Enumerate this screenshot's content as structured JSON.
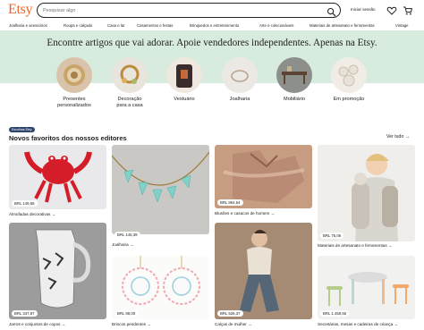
{
  "header": {
    "logo": "Etsy",
    "search_placeholder": "Pesquisar algo",
    "sign_in": "Iniciar sessão"
  },
  "nav": {
    "items": [
      "Joalharia e acessórios",
      "Roupa e calçado",
      "Casa e lar",
      "Casamentos e festas",
      "Brinquedos e entretenimento",
      "Arte e colecionáveis",
      "Materiais de artesanato e ferramentas",
      "Vintage"
    ]
  },
  "hero": {
    "title": "Encontre artigos que vai adorar. Apoie vendedores independentes. Apenas na Etsy."
  },
  "categories": [
    {
      "line1": "Presentes",
      "line2": "personalizados"
    },
    {
      "line1": "Decoração",
      "line2": "para a casa"
    },
    {
      "line1": "Vestuário",
      "line2": ""
    },
    {
      "line1": "Joalharia",
      "line2": ""
    },
    {
      "line1": "Mobiliário",
      "line2": ""
    },
    {
      "line1": "Em promoção",
      "line2": ""
    }
  ],
  "editors": {
    "badge": "Escolhas Etsy",
    "title": "Novos favoritos dos nossos editores",
    "see_all": "Ver tudo",
    "cards": [
      {
        "price": "BRL 149,58",
        "caption": "Almofadas decorativas"
      },
      {
        "price": "BRL 145,39",
        "caption": "Joalharia"
      },
      {
        "price": "BRL 864,54",
        "caption": "Blusões e casacos de homem"
      },
      {
        "price": "BRL 75,06",
        "caption": "Materiais de artesanato e ferramentas"
      },
      {
        "price": "BRL 347,87",
        "caption": "Jarros e conjuntos de copos"
      },
      {
        "price": "BRL 98,00",
        "caption": "Brincos pendentes"
      },
      {
        "price": "BRL 526,37",
        "caption": "Calças de mulher"
      },
      {
        "price": "BRL 1.459,55",
        "caption": "Secretárias, mesas e cadeiras de criança"
      }
    ]
  },
  "colors": {
    "brand": "#F1641E",
    "hero_bg": "#D7EBDF",
    "badge_bg": "#2F466C"
  }
}
